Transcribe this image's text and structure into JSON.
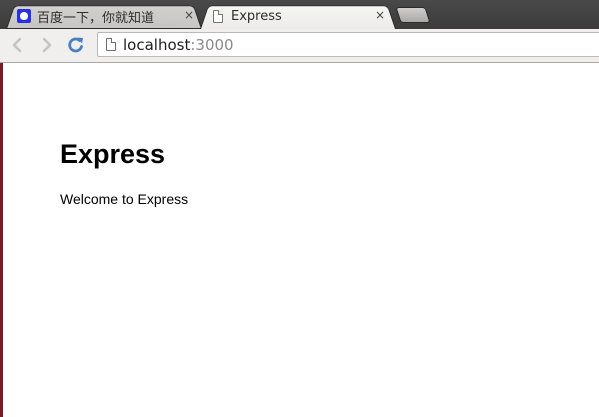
{
  "tabs": [
    {
      "title": "百度一下，你就知道",
      "favicon": "baidu-paw-icon",
      "close": "×",
      "active": false
    },
    {
      "title": "Express",
      "favicon": "document-icon",
      "close": "×",
      "active": true
    }
  ],
  "toolbar": {
    "address": {
      "host": "localhost",
      "port": ":3000"
    }
  },
  "page": {
    "heading": "Express",
    "text": "Welcome to Express"
  },
  "colors": {
    "tab_strip": "#3c3b3b",
    "toolbar": "#f0efee",
    "reload_blue": "#4a7fc1",
    "left_edge": "#7a1b2c"
  }
}
